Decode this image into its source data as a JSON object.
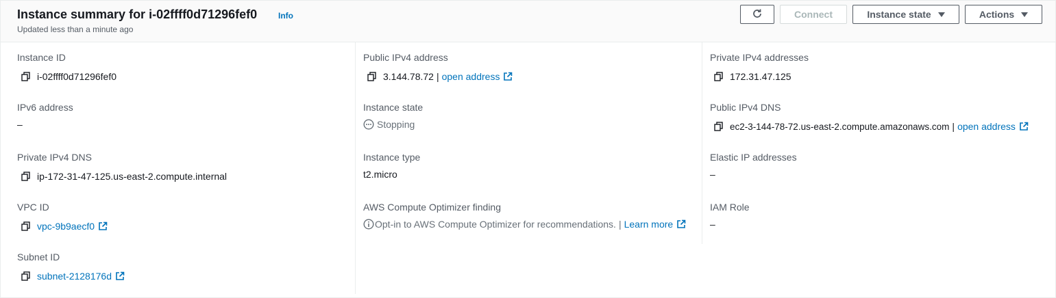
{
  "header": {
    "title": "Instance summary for i-02ffff0d71296fef0",
    "info_label": "Info",
    "updated_text": "Updated less than a minute ago",
    "connect_label": "Connect",
    "instance_state_label": "Instance state",
    "actions_label": "Actions"
  },
  "col1": {
    "instance_id_label": "Instance ID",
    "instance_id": "i-02ffff0d71296fef0",
    "ipv6_label": "IPv6 address",
    "ipv6_value": "–",
    "private_dns_label": "Private IPv4 DNS",
    "private_dns": "ip-172-31-47-125.us-east-2.compute.internal",
    "vpc_label": "VPC ID",
    "vpc_id": "vpc-9b9aecf0",
    "subnet_label": "Subnet ID",
    "subnet_id": "subnet-2128176d"
  },
  "col2": {
    "public_ip_label": "Public IPv4 address",
    "public_ip": "3.144.78.72",
    "public_ip_sep": "|",
    "public_ip_link": "open address",
    "state_label": "Instance state",
    "state_value": "Stopping",
    "type_label": "Instance type",
    "type_value": "t2.micro",
    "optimizer_label": "AWS Compute Optimizer finding",
    "optimizer_text": "Opt-in to AWS Compute Optimizer for recommendations.",
    "optimizer_sep": "|",
    "optimizer_link": "Learn more"
  },
  "col3": {
    "private_ips_label": "Private IPv4 addresses",
    "private_ips": "172.31.47.125",
    "public_dns_label": "Public IPv4 DNS",
    "public_dns": "ec2-3-144-78-72.us-east-2.compute.amazonaws.com",
    "public_dns_sep": "|",
    "public_dns_link": "open address",
    "elastic_label": "Elastic IP addresses",
    "elastic_value": "–",
    "iam_label": "IAM Role",
    "iam_value": "–"
  },
  "colors": {
    "link": "#0073bb",
    "label": "#545b64",
    "text": "#16191f",
    "border": "#eaeded"
  }
}
